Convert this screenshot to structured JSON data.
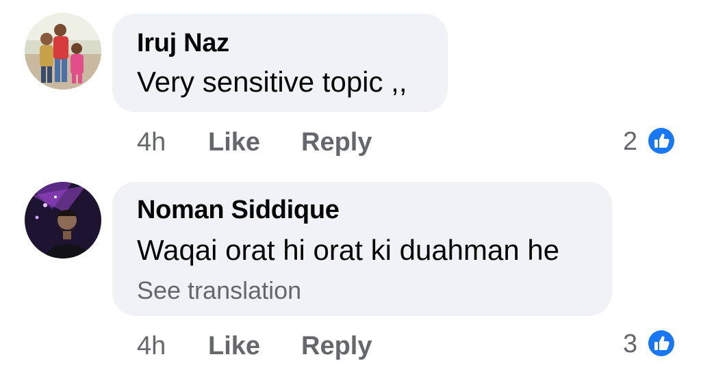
{
  "comments": [
    {
      "author": "Iruj Naz",
      "text": "Very sensitive topic ,,",
      "time": "4h",
      "like_label": "Like",
      "reply_label": "Reply",
      "reaction_count": "2",
      "reaction_icon": "like-reaction-icon"
    },
    {
      "author": "Noman Siddique",
      "text": "Waqai orat hi orat ki duahman he",
      "see_translation": "See translation",
      "time": "4h",
      "like_label": "Like",
      "reply_label": "Reply",
      "reaction_count": "3",
      "reaction_icon": "like-reaction-icon"
    }
  ],
  "colors": {
    "bubble": "#f0f2f5",
    "meta_text": "#65676b",
    "like_blue": "#1877f2"
  }
}
